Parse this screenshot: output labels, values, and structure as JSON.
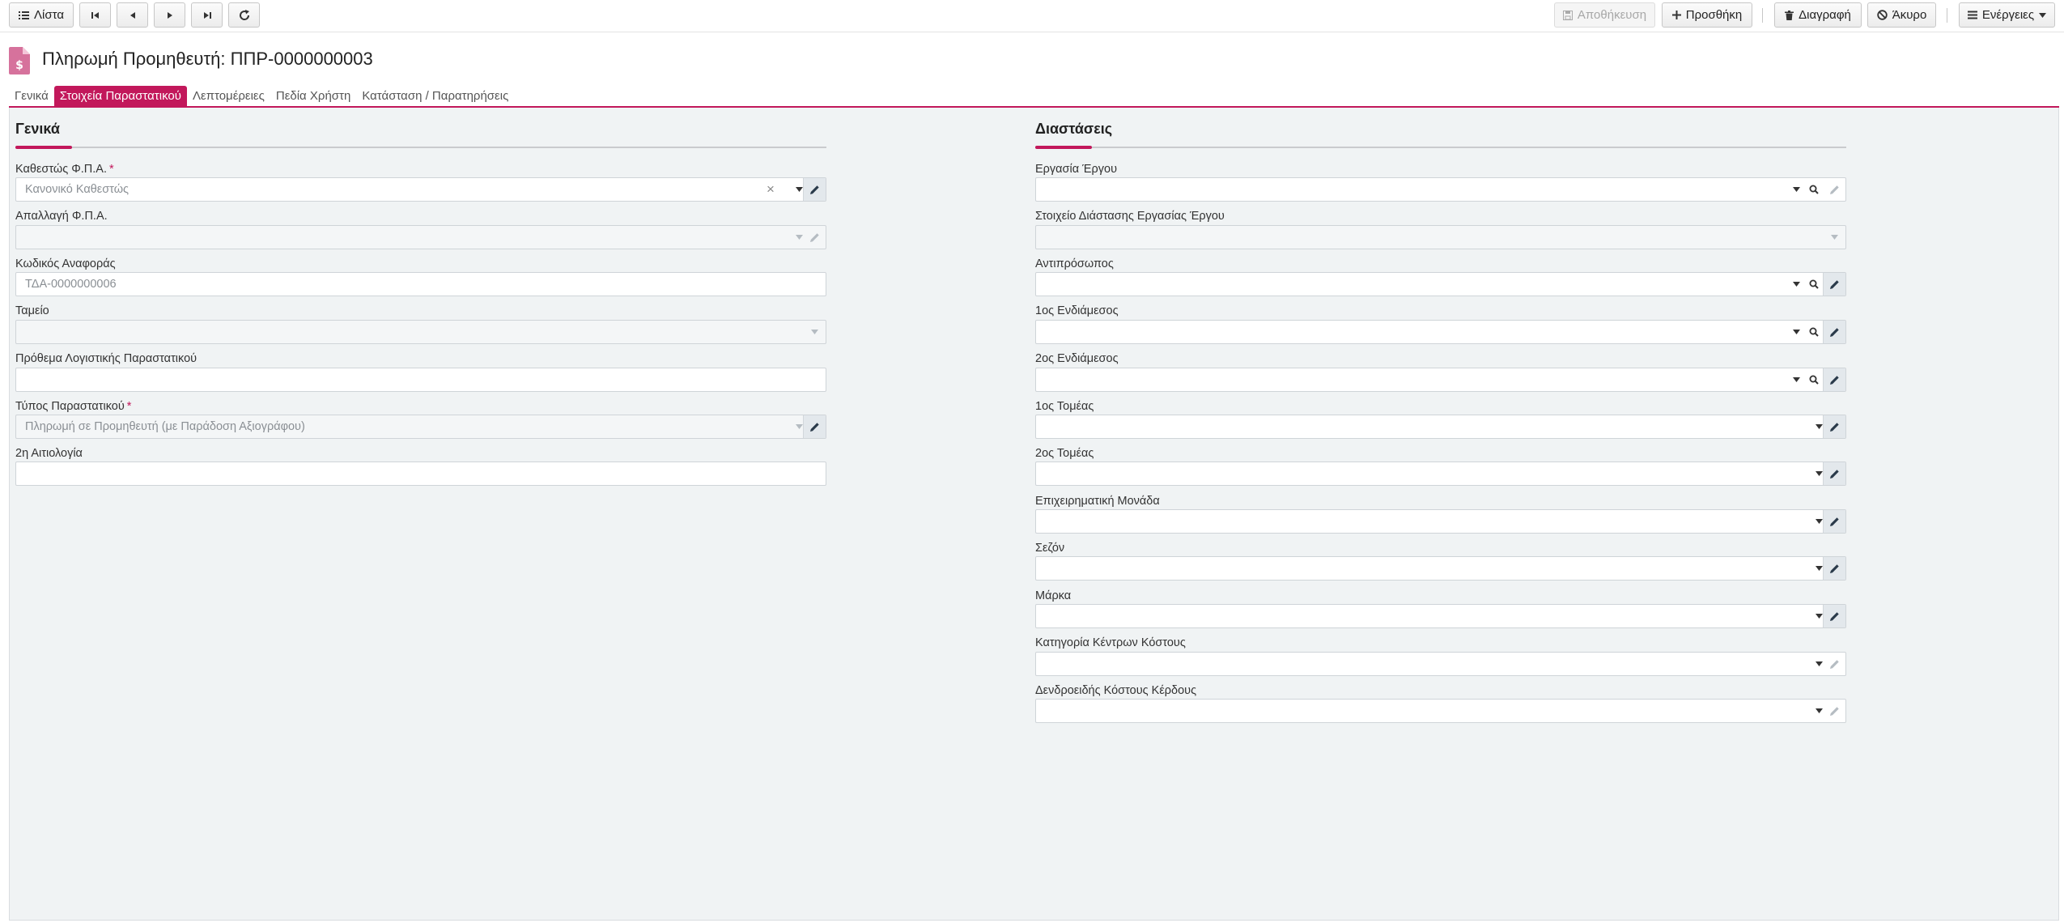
{
  "toolbar": {
    "list_label": "Λίστα",
    "save_label": "Αποθήκευση",
    "add_label": "Προσθήκη",
    "delete_label": "Διαγραφή",
    "cancel_label": "Άκυρο",
    "actions_label": "Ενέργειες"
  },
  "header": {
    "title": "Πληρωμή Προμηθευτή: ΠΠΡ-0000000003"
  },
  "tabs": [
    {
      "label": "Γενικά"
    },
    {
      "label": "Στοιχεία Παραστατικού"
    },
    {
      "label": "Λεπτομέρειες"
    },
    {
      "label": "Πεδία Χρήστη"
    },
    {
      "label": "Κατάσταση / Παρατηρήσεις"
    }
  ],
  "general": {
    "title": "Γενικά",
    "fields": [
      {
        "label": "Καθεστώς Φ.Π.Α.",
        "value": "Κανονικό Καθεστώς",
        "required": "*"
      },
      {
        "label": "Απαλλαγή Φ.Π.Α.",
        "value": ""
      },
      {
        "label": "Κωδικός Αναφοράς",
        "value": "ΤΔΑ-0000000006"
      },
      {
        "label": "Ταμείο",
        "value": ""
      },
      {
        "label": "Πρόθεμα Λογιστικής Παραστατικού",
        "value": ""
      },
      {
        "label": "Τύπος Παραστατικού",
        "value": "Πληρωμή σε Προμηθευτή (με Παράδοση Αξιογράφου)",
        "required": "*"
      },
      {
        "label": "2η Αιτιολογία",
        "value": ""
      }
    ]
  },
  "dimensions": {
    "title": "Διαστάσεις",
    "fields": [
      {
        "label": "Εργασία Έργου",
        "value": ""
      },
      {
        "label": "Στοιχείο Διάστασης Εργασίας Έργου",
        "value": ""
      },
      {
        "label": "Αντιπρόσωπος",
        "value": ""
      },
      {
        "label": "1ος Ενδιάμεσος",
        "value": ""
      },
      {
        "label": "2ος Ενδιάμεσος",
        "value": ""
      },
      {
        "label": "1ος Τομέας",
        "value": ""
      },
      {
        "label": "2ος Τομέας",
        "value": ""
      },
      {
        "label": "Επιχειρηματική Μονάδα",
        "value": ""
      },
      {
        "label": "Σεζόν",
        "value": ""
      },
      {
        "label": "Μάρκα",
        "value": ""
      },
      {
        "label": "Κατηγορία Κέντρων Κόστους",
        "value": ""
      },
      {
        "label": "Δενδροειδής Κόστους Κέρδους",
        "value": ""
      }
    ]
  },
  "colors": {
    "accent": "#c2185b",
    "panel_bg": "#f0f3f4"
  }
}
